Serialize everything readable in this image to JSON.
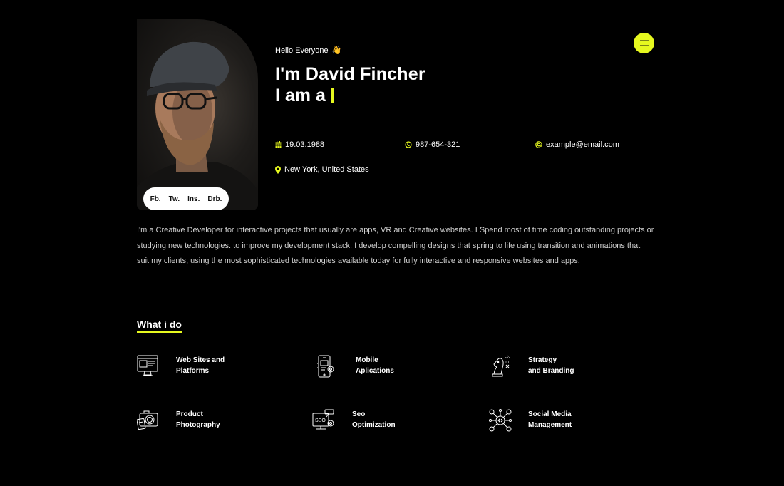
{
  "hero": {
    "greeting": "Hello Everyone",
    "greeting_emoji": "👋",
    "name": "I'm David Fincher",
    "role_prefix": "I am a",
    "accent_color": "#e6f81f"
  },
  "social": [
    {
      "label": "Fb."
    },
    {
      "label": "Tw."
    },
    {
      "label": "Ins."
    },
    {
      "label": "Drb."
    }
  ],
  "menu": {
    "icon": "hamburger-icon"
  },
  "info": {
    "birthday": {
      "icon": "calendar-icon",
      "value": "19.03.1988"
    },
    "phone": {
      "icon": "whatsapp-icon",
      "value": "987-654-321"
    },
    "email": {
      "icon": "at-icon",
      "value": "example@email.com"
    },
    "location": {
      "icon": "location-pin-icon",
      "value": "New York, United States"
    }
  },
  "bio": "I'm a Creative Developer for interactive projects that usually are apps, VR and Creative websites. I Spend most of time coding outstanding projects or studying new technologies. to improve my development stack. I develop compelling designs that spring to life using transition and animations that suit my clients, using the most sophisticated technologies available today for fully interactive and responsive websites and apps.",
  "services_title": "What i do",
  "services": [
    {
      "line1": "Web Sites and",
      "line2": "Platforms",
      "icon": "web-platform-icon"
    },
    {
      "line1": "Mobile",
      "line2": "Aplications",
      "icon": "mobile-app-icon"
    },
    {
      "line1": "Strategy",
      "line2": "and Branding",
      "icon": "chess-knight-icon"
    },
    {
      "line1": "Product",
      "line2": "Photography",
      "icon": "camera-icon"
    },
    {
      "line1": "Seo",
      "line2": "Optimization",
      "icon": "seo-monitor-icon"
    },
    {
      "line1": "Social Media",
      "line2": "Management",
      "icon": "social-network-icon"
    }
  ]
}
